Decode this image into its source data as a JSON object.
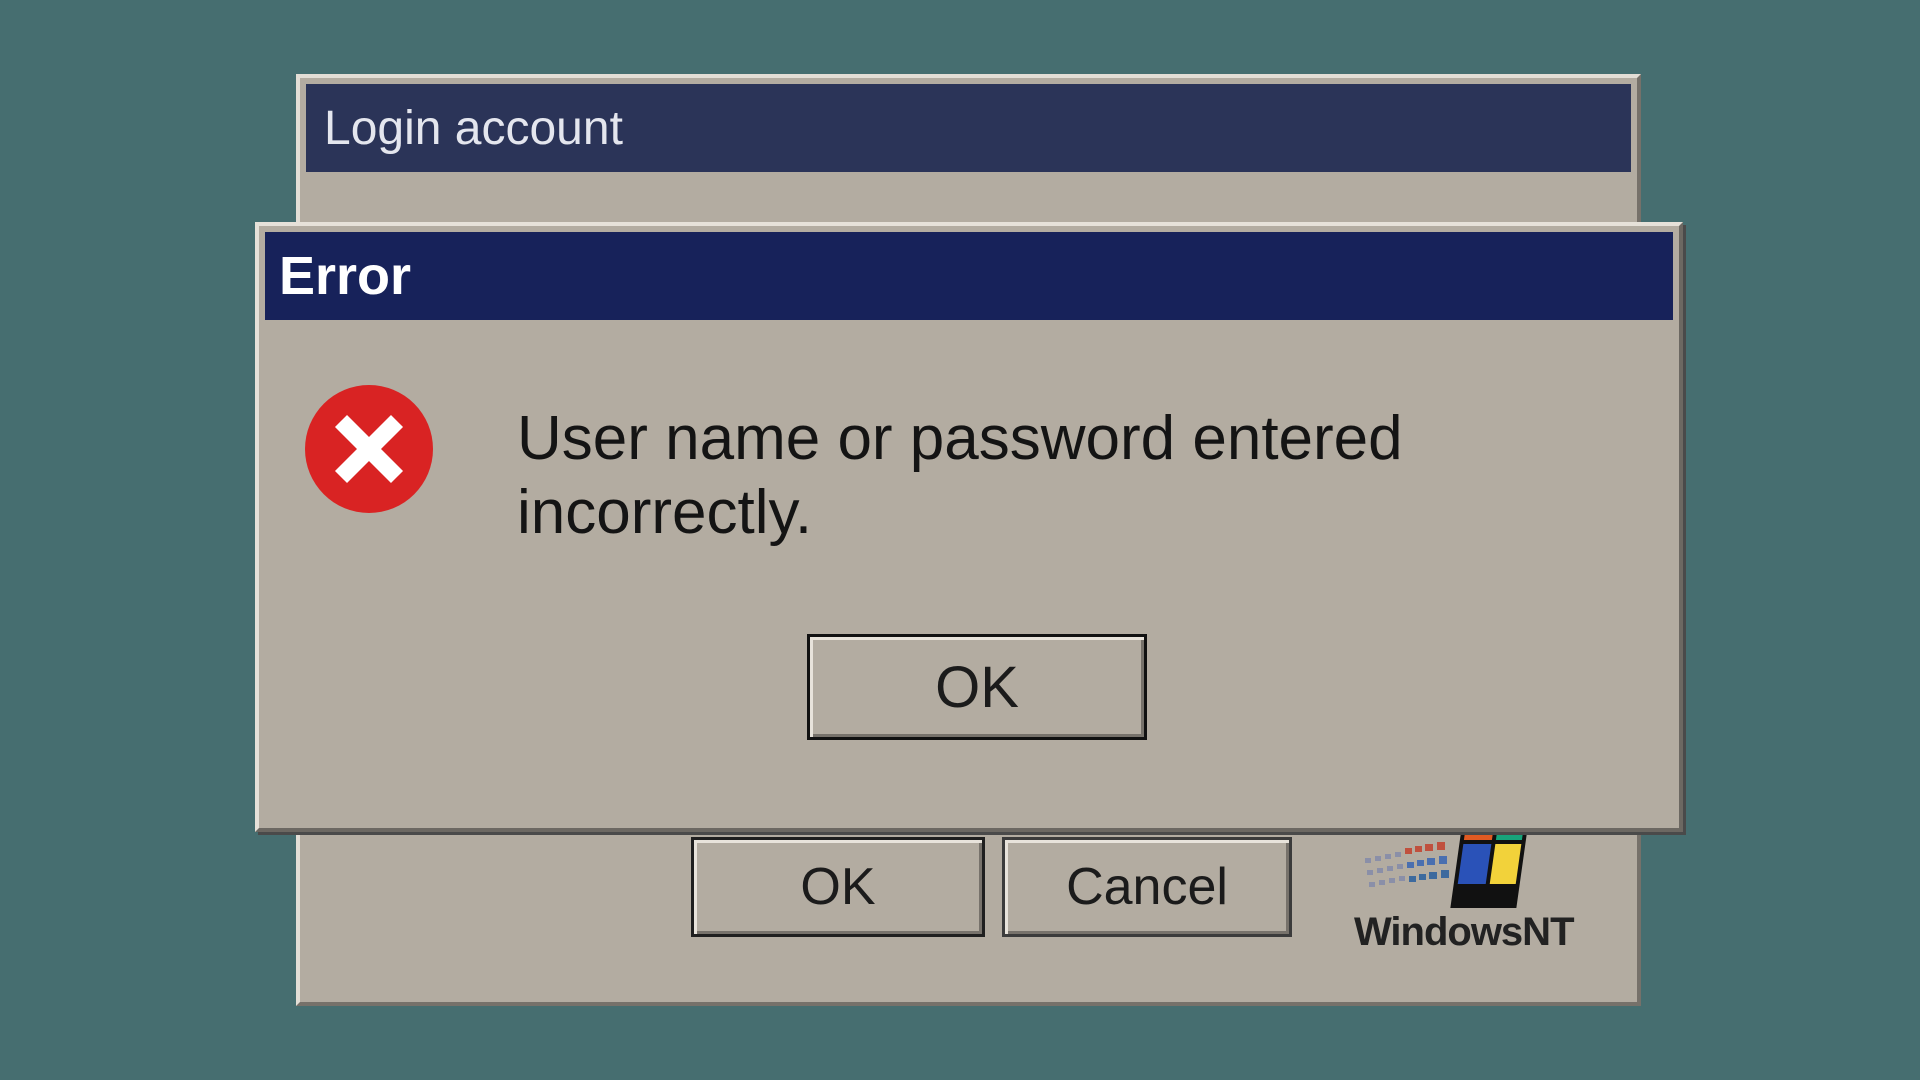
{
  "login_window": {
    "title": "Login account",
    "ok_label": "OK",
    "cancel_label": "Cancel",
    "logo_text": "WindowsNT"
  },
  "error_dialog": {
    "title": "Error",
    "icon": "error-x-icon",
    "message": "User name or password entered incorrectly.",
    "ok_label": "OK"
  },
  "colors": {
    "desktop": "#466e70",
    "window_face": "#b3aca1",
    "error_titlebar": "#17225a",
    "login_titlebar": "#2b3458",
    "error_icon": "#d92323"
  }
}
